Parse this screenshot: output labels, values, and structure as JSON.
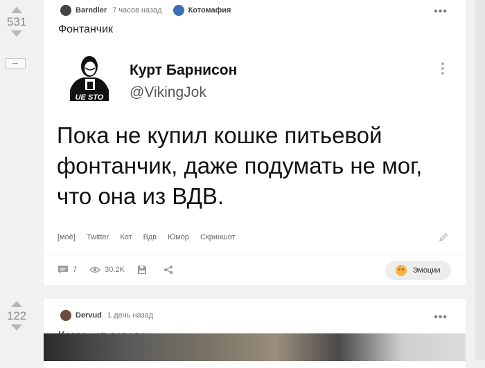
{
  "story1": {
    "rating": "531",
    "author": "Barndler",
    "time": "7 часов назад",
    "community": "Котомафия",
    "more": "•••",
    "title": "Фонтанчик",
    "tweet": {
      "name": "Курт Барнисон",
      "handle": "@VikingJok",
      "text": "Пока не купил кошке питьевой фонтанчик, даже подумать не мог, что она из ВДВ.",
      "avatar_caption": "UE STO"
    },
    "tags": [
      "[моё]",
      "Twitter",
      "Кот",
      "Вдв",
      "Юмор",
      "Скриншот"
    ],
    "comments": "7",
    "views": "30.2K",
    "emotions_label": "Эмоции"
  },
  "story2": {
    "rating": "122",
    "author": "Dervud",
    "time": "1 день назад",
    "more": "•••",
    "title": "Когда кот доволен"
  }
}
